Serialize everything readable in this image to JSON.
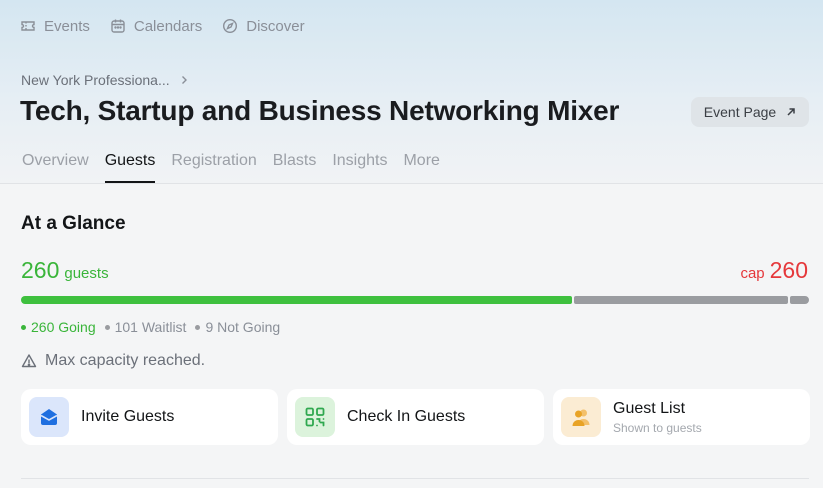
{
  "nav": {
    "items": [
      {
        "label": "Events",
        "icon": "ticket-icon"
      },
      {
        "label": "Calendars",
        "icon": "calendar-icon"
      },
      {
        "label": "Discover",
        "icon": "compass-icon"
      }
    ]
  },
  "breadcrumb": {
    "label": "New York Professiona..."
  },
  "event": {
    "title": "Tech, Startup and Business Networking Mixer",
    "event_page_label": "Event Page"
  },
  "tabs": [
    {
      "label": "Overview",
      "active": false
    },
    {
      "label": "Guests",
      "active": true
    },
    {
      "label": "Registration",
      "active": false
    },
    {
      "label": "Blasts",
      "active": false
    },
    {
      "label": "Insights",
      "active": false
    },
    {
      "label": "More",
      "active": false
    }
  ],
  "glance": {
    "title": "At a Glance",
    "guest_count": "260",
    "guest_label": "guests",
    "cap_label": "cap",
    "cap_value": "260",
    "bar": {
      "going": 260,
      "waitlist": 101,
      "not_going": 9
    },
    "legend": {
      "going": "260 Going",
      "waitlist": "101 Waitlist",
      "not_going": "9 Not Going"
    },
    "capacity_note": "Max capacity reached."
  },
  "actions": {
    "invite": {
      "label": "Invite Guests"
    },
    "checkin": {
      "label": "Check In Guests"
    },
    "list": {
      "label": "Guest List",
      "sub": "Shown to guests"
    }
  },
  "colors": {
    "going": "#3ec03e",
    "cap": "#e5383b",
    "waitlist": "#9a9ca0",
    "invite_icon": "#1f6fe0",
    "checkin_icon": "#2fa84f",
    "list_icon": "#e8a326"
  }
}
